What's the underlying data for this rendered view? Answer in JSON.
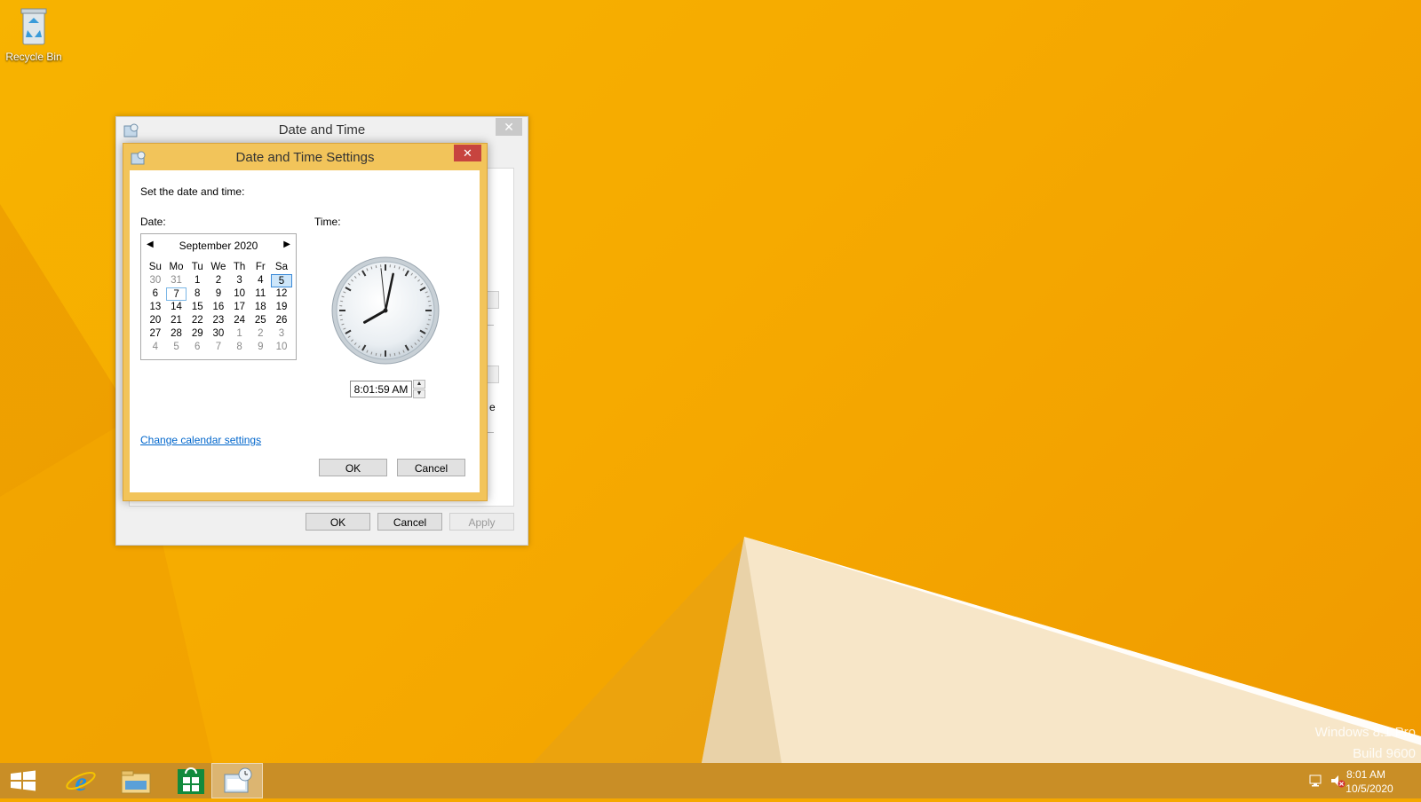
{
  "desktop": {
    "recycle_bin_label": "Recycle Bin",
    "watermark_line1": "Windows 8.1 Pro",
    "watermark_line2": "Build 9600"
  },
  "outer_dialog": {
    "title": "Date and Time",
    "close_glyph": "✕",
    "fragment_text": "e",
    "buttons": {
      "ok": "OK",
      "cancel": "Cancel",
      "apply": "Apply"
    }
  },
  "settings_dialog": {
    "title": "Date and Time Settings",
    "close_glyph": "✕",
    "instruction": "Set the date and time:",
    "date_label": "Date:",
    "time_label": "Time:",
    "change_calendar_link": "Change calendar settings",
    "buttons": {
      "ok": "OK",
      "cancel": "Cancel"
    },
    "calendar": {
      "month_label": "September 2020",
      "prev_glyph": "◀",
      "next_glyph": "▶",
      "weekdays": [
        "Su",
        "Mo",
        "Tu",
        "We",
        "Th",
        "Fr",
        "Sa"
      ],
      "weeks": [
        [
          "30",
          "31",
          "1",
          "2",
          "3",
          "4",
          "5"
        ],
        [
          "6",
          "7",
          "8",
          "9",
          "10",
          "11",
          "12"
        ],
        [
          "13",
          "14",
          "15",
          "16",
          "17",
          "18",
          "19"
        ],
        [
          "20",
          "21",
          "22",
          "23",
          "24",
          "25",
          "26"
        ],
        [
          "27",
          "28",
          "29",
          "30",
          "1",
          "2",
          "3"
        ],
        [
          "4",
          "5",
          "6",
          "7",
          "8",
          "9",
          "10"
        ]
      ],
      "selected_day": "5",
      "hover_day": "7"
    },
    "clock": {
      "hour": 8,
      "minute": 1,
      "second": 59
    },
    "time_value": "8:01:59 AM",
    "spin_up": "▲",
    "spin_down": "▼"
  },
  "taskbar": {
    "items": [
      "start-button",
      "internet-explorer",
      "file-explorer",
      "store",
      "date-time-app"
    ],
    "clock_time": "8:01 AM",
    "clock_date": "10/5/2020"
  }
}
